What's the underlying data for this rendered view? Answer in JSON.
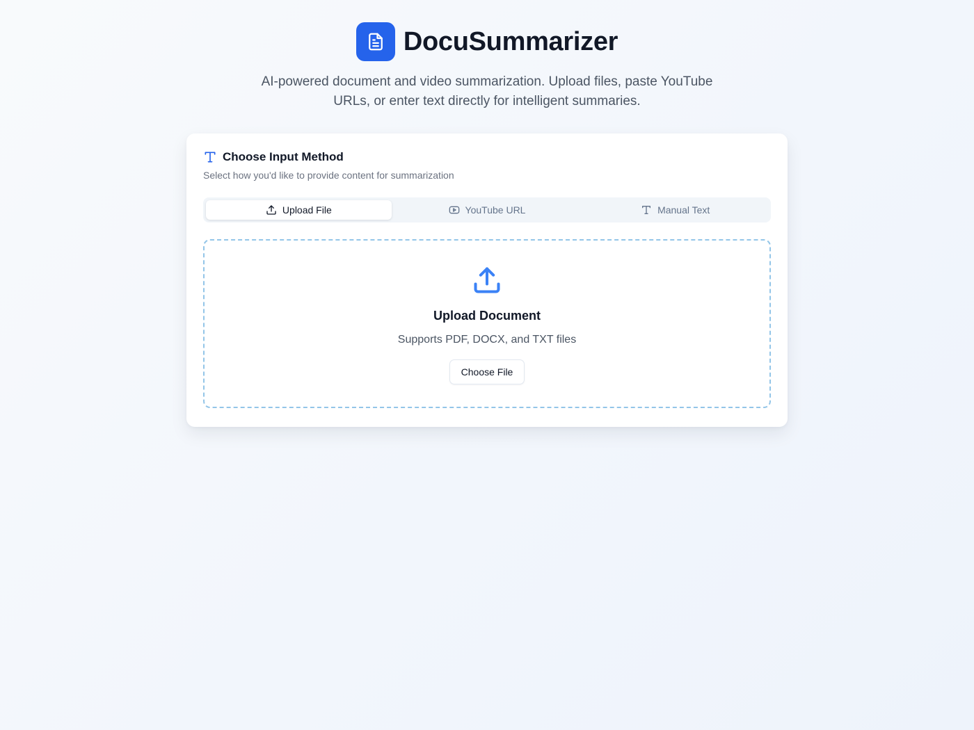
{
  "app": {
    "title": "DocuSummarizer",
    "tagline": "AI-powered document and video summarization. Upload files, paste YouTube URLs, or enter text directly for intelligent summaries.",
    "logo_icon": "document-icon",
    "brand_color": "#2563eb"
  },
  "card": {
    "icon": "text-icon",
    "title": "Choose Input Method",
    "subtitle": "Select how you'd like to provide content for summarization"
  },
  "tabs": [
    {
      "label": "Upload File",
      "icon": "upload-icon",
      "active": true
    },
    {
      "label": "YouTube URL",
      "icon": "video-icon",
      "active": false
    },
    {
      "label": "Manual Text",
      "icon": "text-icon",
      "active": false
    }
  ],
  "dropzone": {
    "icon": "upload-icon",
    "title": "Upload Document",
    "subtitle": "Supports PDF, DOCX, and TXT files",
    "button_label": "Choose File"
  }
}
